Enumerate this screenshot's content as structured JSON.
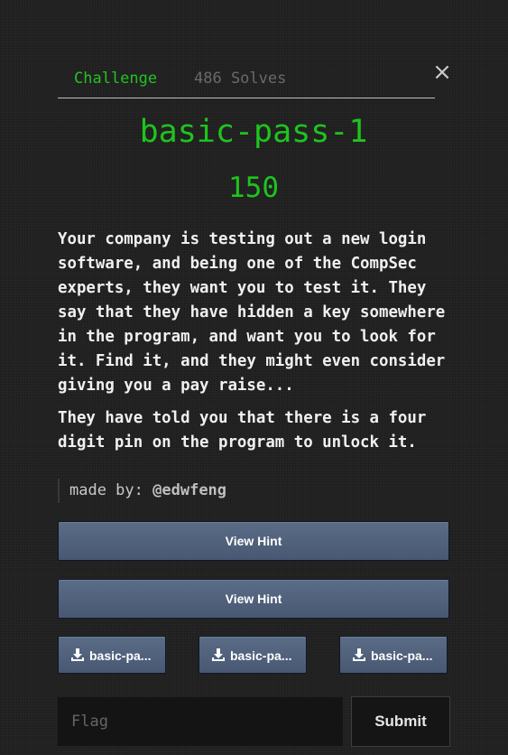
{
  "tabs": {
    "challenge_label": "Challenge",
    "solves_label": "486 Solves"
  },
  "close_icon": "×",
  "challenge": {
    "name": "basic-pass-1",
    "value": "150",
    "description": [
      "Your company is testing out a new login software, and being one of the CompSec experts, they want you to test it. They say that they have hidden a key somewhere in the program, and want you to look for it. Find it, and they might even consider giving you a pay raise...",
      "They have told you that there is a four digit pin on the program to unlock it."
    ],
    "author_prefix": "made by:",
    "author_handle": "@edwfeng"
  },
  "hints": [
    {
      "label": "View Hint"
    },
    {
      "label": "View Hint"
    }
  ],
  "files": [
    {
      "label": "basic-pa...",
      "icon": "download-icon"
    },
    {
      "label": "basic-pa...",
      "icon": "download-icon"
    },
    {
      "label": "basic-pa...",
      "icon": "download-icon"
    }
  ],
  "flag_form": {
    "placeholder": "Flag",
    "value": "",
    "submit_label": "Submit"
  },
  "colors": {
    "accent_green": "#1ec41e",
    "button_blue": "#50607a",
    "background": "#222222"
  }
}
